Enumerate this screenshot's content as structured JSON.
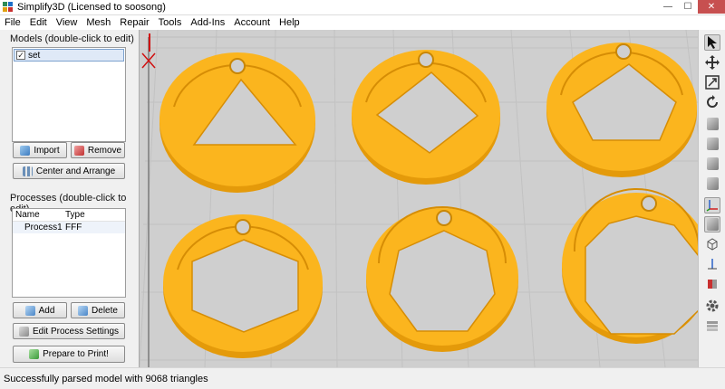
{
  "window": {
    "title": "Simplify3D (Licensed to soosong)",
    "controls": {
      "minimize": "—",
      "maximize": "☐",
      "close": "✕"
    }
  },
  "menu": [
    "File",
    "Edit",
    "View",
    "Mesh",
    "Repair",
    "Tools",
    "Add-Ins",
    "Account",
    "Help"
  ],
  "models": {
    "label": "Models (double-click to edit)",
    "items": [
      {
        "name": "set",
        "checked": true
      }
    ],
    "import_label": "Import",
    "remove_label": "Remove",
    "center_label": "Center and Arrange"
  },
  "processes": {
    "label": "Processes (double-click to edit)",
    "columns": [
      "Name",
      "Type"
    ],
    "rows": [
      {
        "name": "Process1",
        "type": "FFF"
      }
    ],
    "add_label": "Add",
    "delete_label": "Delete",
    "edit_label": "Edit Process Settings",
    "prepare_label": "Prepare to Print!"
  },
  "viewport": {
    "model_color": "#fbb51e",
    "model_edge_color": "#e49a0a",
    "grid_color": "#c2c2c2",
    "background": "#cfcfcf",
    "cutout_shapes": [
      "triangle",
      "square",
      "pentagon",
      "hexagon",
      "heptagon",
      "octagon"
    ]
  },
  "toolbar_icons": [
    "select-arrow-icon",
    "move-icon",
    "scale-icon",
    "rotate-icon",
    "view-front-icon",
    "view-top-icon",
    "view-side-icon",
    "view-iso-icon",
    "axis-icon",
    "solid-cube-icon",
    "wireframe-cube-icon",
    "z-axis-icon",
    "cross-section-icon",
    "settings-gear-icon",
    "layers-icon"
  ],
  "status": {
    "message": "Successfully parsed model with 9068 triangles"
  }
}
